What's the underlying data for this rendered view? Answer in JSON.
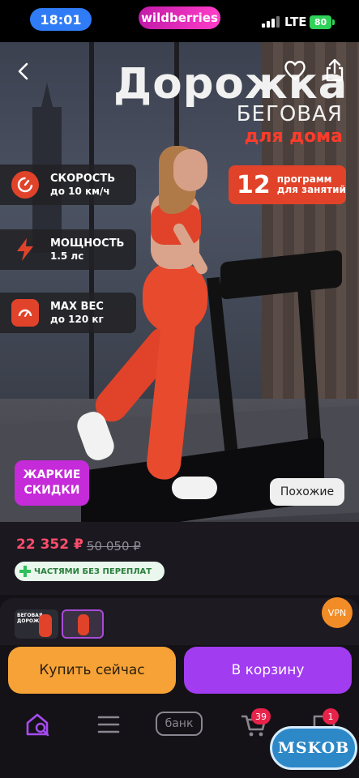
{
  "status_bar": {
    "time": "18:01",
    "app_pill": "wildberries",
    "network": "LTE",
    "battery": "80"
  },
  "hero": {
    "title": "Дорожка",
    "subtitle": "БЕГОВАЯ",
    "subtitle_accent": "для дома",
    "programs_count": "12",
    "programs_line1": "программ",
    "programs_line2": "для занятий",
    "features": [
      {
        "icon": "speedometer-icon",
        "title": "СКОРОСТЬ",
        "value": "до 10 км/ч"
      },
      {
        "icon": "lightning-icon",
        "title": "МОЩНОСТЬ",
        "value": "1.5 лс"
      },
      {
        "icon": "scale-icon",
        "title": "MAX ВЕС",
        "value": "до 120 кг"
      }
    ],
    "hot_badge_line1": "ЖАРКИЕ",
    "hot_badge_line2": "СКИДКИ",
    "similar_label": "Похожие"
  },
  "product": {
    "price": "22 352 ₽",
    "old_price": "50 050 ₽",
    "installment": "ЧАСТЯМИ БЕЗ ПЕРЕПЛАТ"
  },
  "thumbnails": {
    "first_caption": "БЕГОВАЯ ДОРОЖКА"
  },
  "vpn_label": "VPN",
  "actions": {
    "buy_now": "Купить сейчас",
    "to_cart": "В корзину"
  },
  "nav": {
    "bank": "банк",
    "cart_badge": "39",
    "chat_badge": "1"
  },
  "watermark": "MSKOB",
  "colors": {
    "accent_red": "#e0432a",
    "price_pink": "#ff4d6b",
    "buy_orange": "#f6a236",
    "cart_purple": "#a13cf0"
  }
}
